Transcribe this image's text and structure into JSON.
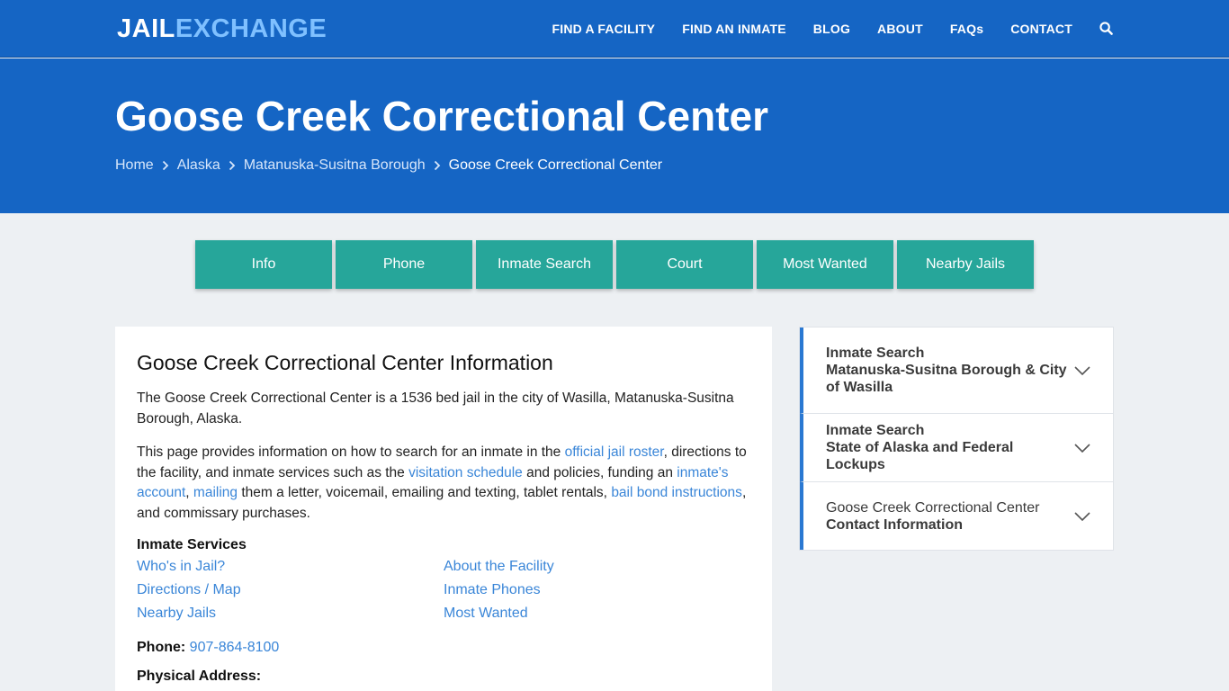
{
  "header": {
    "logo_part1": "JAIL",
    "logo_part2": "EXCHANGE",
    "nav": [
      "FIND A FACILITY",
      "FIND AN INMATE",
      "BLOG",
      "ABOUT",
      "FAQs",
      "CONTACT"
    ],
    "search_icon": "search-icon"
  },
  "hero": {
    "title": "Goose Creek Correctional Center",
    "breadcrumb": [
      "Home",
      "Alaska",
      "Matanuska-Susitna Borough"
    ],
    "breadcrumb_current": "Goose Creek Correctional Center"
  },
  "tabs": [
    "Info",
    "Phone",
    "Inmate Search",
    "Court",
    "Most Wanted",
    "Nearby Jails"
  ],
  "main": {
    "heading": "Goose Creek Correctional Center Information",
    "intro": "The Goose Creek Correctional Center is a 1536 bed jail in the city of Wasilla, Matanuska-Susitna Borough, Alaska.",
    "p2": {
      "t1": "This page provides information on how to search for an inmate in the ",
      "link1": "official jail roster",
      "t2": ", directions to the facility, and inmate services such as the ",
      "link2": "visitation schedule",
      "t3": " and policies, funding an ",
      "link3": "inmate's account",
      "t4": ", ",
      "link4": "mailing",
      "t5": " them a letter, voicemail, emailing and texting, tablet rentals, ",
      "link5": "bail bond instructions",
      "t6": ", and commissary purchases."
    },
    "services_heading": "Inmate Services",
    "services": [
      "Who's in Jail?",
      "About the Facility",
      "Directions / Map",
      "Inmate Phones",
      "Nearby Jails",
      "Most Wanted"
    ],
    "phone_label": "Phone:",
    "phone_value": "907-864-8100",
    "address_label": "Physical Address:"
  },
  "sidebar": [
    {
      "line1": "Inmate Search",
      "line2": "Matanuska-Susitna Borough & City of Wasilla"
    },
    {
      "line1": "Inmate Search",
      "line2": "State of Alaska and Federal Lockups"
    },
    {
      "line1": "Goose Creek Correctional Center",
      "line2": "Contact Information"
    }
  ],
  "colors": {
    "brand_blue": "#1565c4",
    "tab_teal": "#26a69a",
    "link_blue": "#3a86d8",
    "accent_border": "#2a78d2"
  }
}
